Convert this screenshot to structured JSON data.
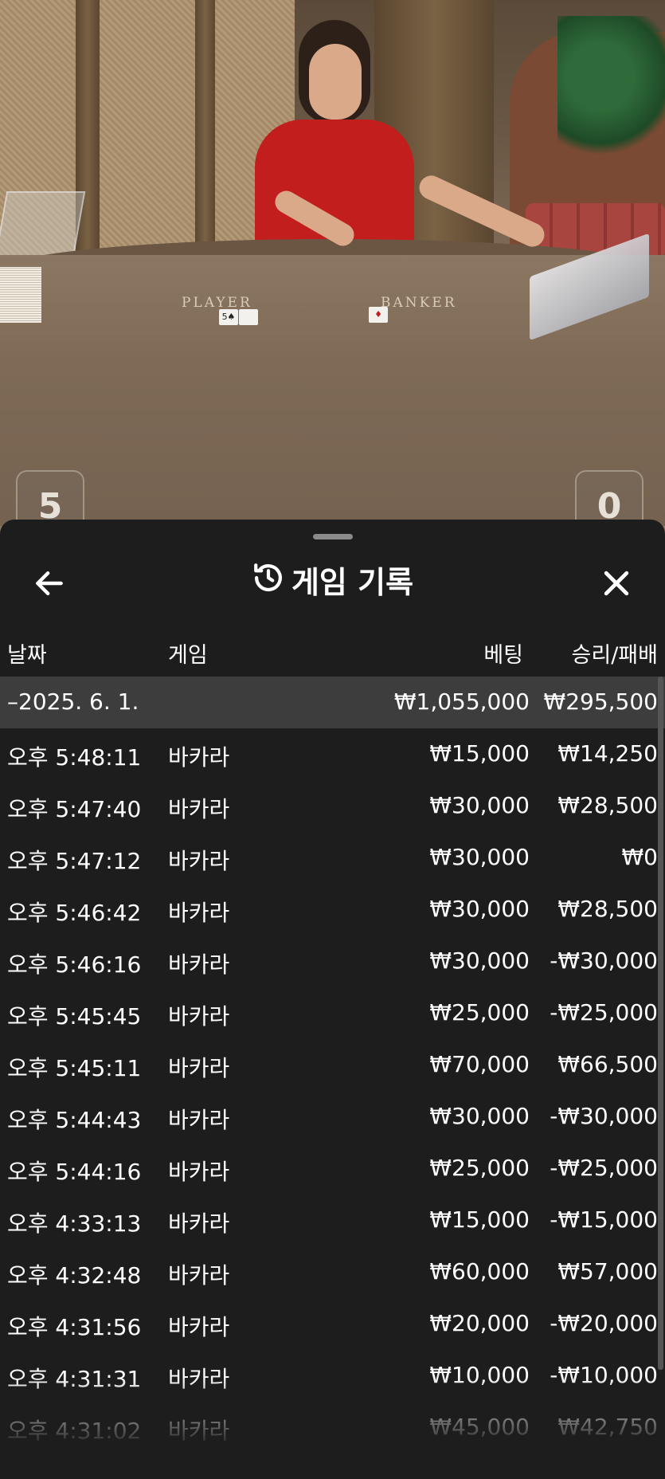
{
  "scene": {
    "felt_left": "PLAYER",
    "felt_right": "BANKER",
    "card_player": "5♠",
    "card_banker": "♦",
    "player_score": "5",
    "banker_score": "0"
  },
  "sheet": {
    "title": "게임 기록",
    "icons": {
      "back": "arrow-left-icon",
      "history": "history-icon",
      "close": "close-icon"
    },
    "columns": {
      "date": "날짜",
      "game": "게임",
      "bet": "베팅",
      "result": "승리/패배"
    },
    "group": {
      "date": "–2025. 6. 1.",
      "bet": "₩1,055,000",
      "result": "₩295,500"
    },
    "rows": [
      {
        "time": "오후 5:48:11",
        "game": "바카라",
        "bet": "₩15,000",
        "result": "₩14,250"
      },
      {
        "time": "오후 5:47:40",
        "game": "바카라",
        "bet": "₩30,000",
        "result": "₩28,500"
      },
      {
        "time": "오후 5:47:12",
        "game": "바카라",
        "bet": "₩30,000",
        "result": "₩0"
      },
      {
        "time": "오후 5:46:42",
        "game": "바카라",
        "bet": "₩30,000",
        "result": "₩28,500"
      },
      {
        "time": "오후 5:46:16",
        "game": "바카라",
        "bet": "₩30,000",
        "result": "-₩30,000"
      },
      {
        "time": "오후 5:45:45",
        "game": "바카라",
        "bet": "₩25,000",
        "result": "-₩25,000"
      },
      {
        "time": "오후 5:45:11",
        "game": "바카라",
        "bet": "₩70,000",
        "result": "₩66,500"
      },
      {
        "time": "오후 5:44:43",
        "game": "바카라",
        "bet": "₩30,000",
        "result": "-₩30,000"
      },
      {
        "time": "오후 5:44:16",
        "game": "바카라",
        "bet": "₩25,000",
        "result": "-₩25,000"
      },
      {
        "time": "오후 4:33:13",
        "game": "바카라",
        "bet": "₩15,000",
        "result": "-₩15,000"
      },
      {
        "time": "오후 4:32:48",
        "game": "바카라",
        "bet": "₩60,000",
        "result": "₩57,000"
      },
      {
        "time": "오후 4:31:56",
        "game": "바카라",
        "bet": "₩20,000",
        "result": "-₩20,000"
      },
      {
        "time": "오후 4:31:31",
        "game": "바카라",
        "bet": "₩10,000",
        "result": "-₩10,000"
      },
      {
        "time": "오후 4:31:02",
        "game": "바카라",
        "bet": "₩45,000",
        "result": "₩42,750"
      }
    ]
  }
}
